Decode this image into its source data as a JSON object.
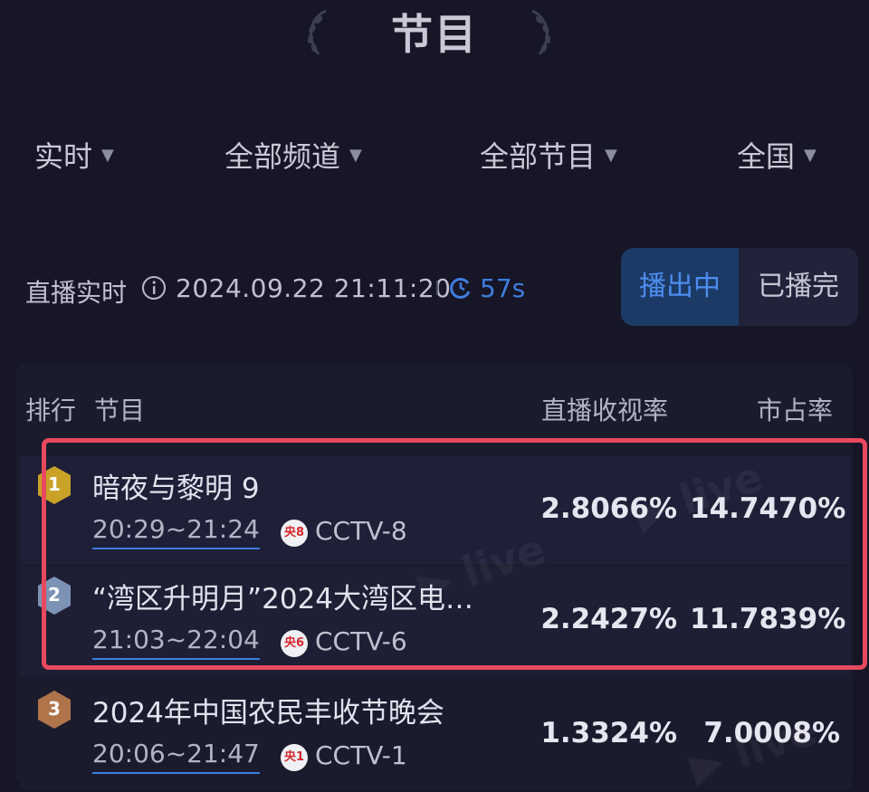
{
  "header": {
    "title": "节目"
  },
  "filters": [
    {
      "label": "实时"
    },
    {
      "label": "全部频道"
    },
    {
      "label": "全部节目"
    },
    {
      "label": "全国"
    }
  ],
  "status": {
    "label": "直播实时",
    "timestamp": "2024.09.22 21:11:20",
    "refresh_countdown": "57s",
    "tabs": [
      {
        "label": "播出中",
        "active": true
      },
      {
        "label": "已播完",
        "active": false
      }
    ]
  },
  "table": {
    "headers": {
      "rank": "排行",
      "program": "节目",
      "rating": "直播收视率",
      "share": "市占率"
    },
    "rows": [
      {
        "rank": "1",
        "title": "暗夜与黎明 9",
        "time": "20:29~21:24",
        "channel_badge": "央8",
        "channel": "CCTV-8",
        "rating": "2.8066%",
        "share": "14.7470%",
        "badge_color": "#c9a227"
      },
      {
        "rank": "2",
        "title": "“湾区升明月”2024大湾区电…",
        "time": "21:03~22:04",
        "channel_badge": "央6",
        "channel": "CCTV-6",
        "rating": "2.2427%",
        "share": "11.7839%",
        "badge_color": "#7c93b6"
      },
      {
        "rank": "3",
        "title": "2024年中国农民丰收节晚会",
        "time": "20:06~21:47",
        "channel_badge": "央1",
        "channel": "CCTV-1",
        "rating": "1.3324%",
        "share": "7.0008%",
        "badge_color": "#b0744a"
      }
    ]
  },
  "colors": {
    "accent": "#3f7de0",
    "highlight": "#e8495f",
    "background": "#161627"
  }
}
